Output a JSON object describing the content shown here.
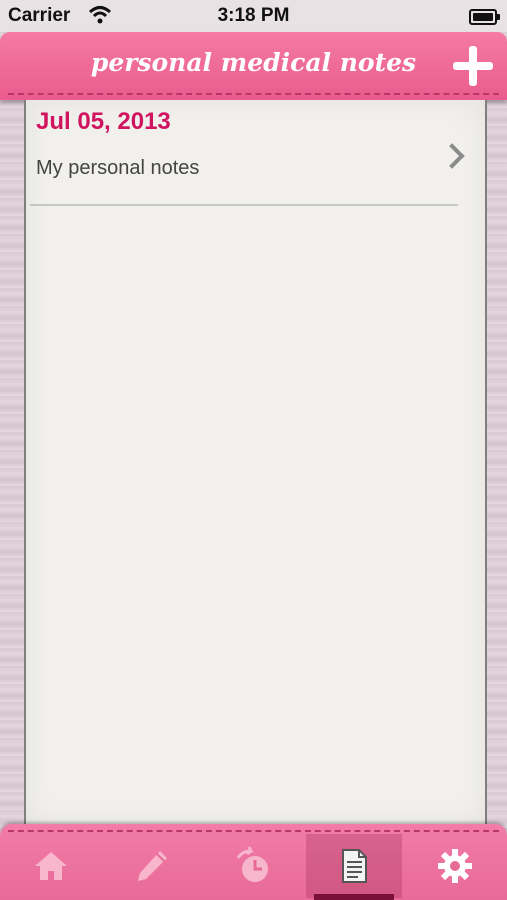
{
  "status": {
    "carrier": "Carrier",
    "time": "3:18 PM"
  },
  "header": {
    "title": "personal medical notes",
    "add_icon": "plus-icon"
  },
  "notes": [
    {
      "date": "Jul 05, 2013",
      "text": "My personal notes"
    }
  ],
  "tabs": [
    {
      "icon": "home-icon"
    },
    {
      "icon": "pencil-icon"
    },
    {
      "icon": "reminder-clock-icon"
    },
    {
      "icon": "notes-document-icon",
      "selected": true
    },
    {
      "icon": "gear-icon"
    }
  ],
  "colors": {
    "accent": "#ea5c8d",
    "date": "#d0145f",
    "selected_tab": "#7a1238"
  }
}
